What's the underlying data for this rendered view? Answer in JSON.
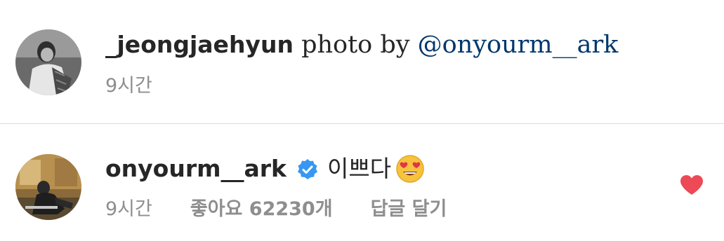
{
  "caption": {
    "username": "_jeongjaehyun",
    "text": " photo by ",
    "mention": "@onyourm__ark",
    "time": "9시간",
    "avatar": "profile-photo-grayscale"
  },
  "comment": {
    "username": "onyourm__ark",
    "verified_icon": "verified-badge-icon",
    "text": "이쁘다",
    "emoji": "heart-eyes-emoji",
    "time": "9시간",
    "likes": "좋아요 62230개",
    "reply": "답글 달기",
    "liked": true,
    "avatar": "profile-photo-color"
  },
  "colors": {
    "text": "#262626",
    "mention": "#00376b",
    "meta": "#8e8e8e",
    "divider": "#dbdbdb",
    "verified": "#3897f0",
    "heart": "#ed4956"
  }
}
